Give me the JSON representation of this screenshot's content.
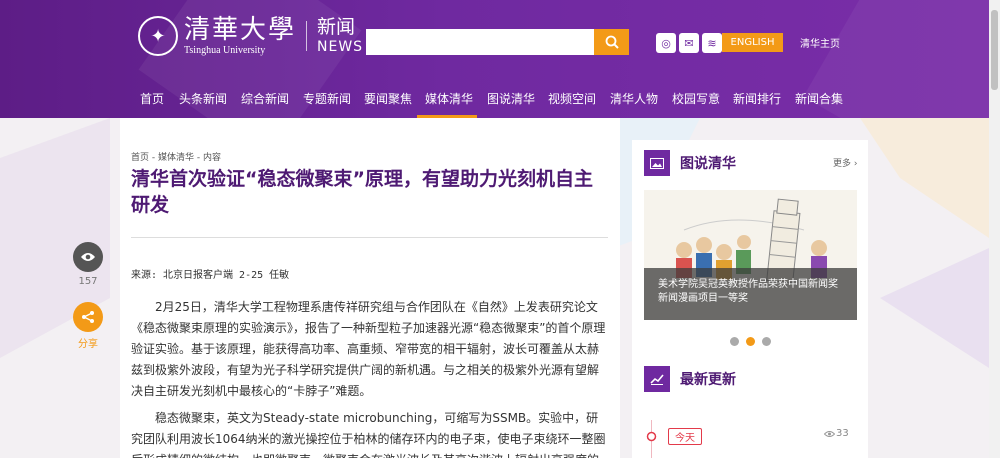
{
  "header": {
    "logo_cn": "清華大學",
    "logo_en": "Tsinghua University",
    "news_cn": "新闻",
    "news_en": "NEWS",
    "search_placeholder": "",
    "english_label": "ENGLISH",
    "home_link": "清华主页",
    "social_icons": [
      "weibo-icon",
      "wechat-icon",
      "rss-icon"
    ],
    "accent_color": "#f39a17",
    "brand_color": "#6f29a0"
  },
  "nav": {
    "items": [
      "首页",
      "头条新闻",
      "综合新闻",
      "专题新闻",
      "要闻聚焦",
      "媒体清华",
      "图说清华",
      "视频空间",
      "清华人物",
      "校园写意",
      "新闻排行",
      "新闻合集"
    ],
    "active": "媒体清华"
  },
  "article": {
    "breadcrumb": "首页 - 媒体清华 - 内容",
    "title": "清华首次验证“稳态微聚束”原理，有望助力光刻机自主研发",
    "source": "来源: 北京日报客户端 2-25 任敏",
    "paragraphs": [
      "2月25日，清华大学工程物理系唐传祥研究组与合作团队在《自然》上发表研究论文《稳态微聚束原理的实验演示》，报告了一种新型粒子加速器光源“稳态微聚束”的首个原理验证实验。基于该原理，能获得高功率、高重频、窄带宽的相干辐射，波长可覆盖从太赫兹到极紫外波段，有望为光子科学研究提供广阔的新机遇。与之相关的极紫外光源有望解决自主研发光刻机中最核心的“卡脖子”难题。",
      "稳态微聚束，英文为Steady-state microbunching，可缩写为SSMB。实验中，研究团队利用波长1064纳米的激光操控位于柏林的储存环内的电子束，使电子束绕环一整圈后形成精细的微结构，也即微聚束。微聚束会在激光波长及其高次谐波上辐射出高强度的窄带宽相"
    ]
  },
  "actions": {
    "views_count": "157",
    "share_label": "分享"
  },
  "sidebar": {
    "photo_section": {
      "title": "图说清华",
      "more": "更多 ›",
      "caption": "美术学院吴冠英教授作品荣获中国新闻奖新闻漫画项目一等奖",
      "slides": 3,
      "active_slide": 2
    },
    "updates": {
      "title": "最新更新",
      "today_label": "今天",
      "count": "33"
    }
  }
}
